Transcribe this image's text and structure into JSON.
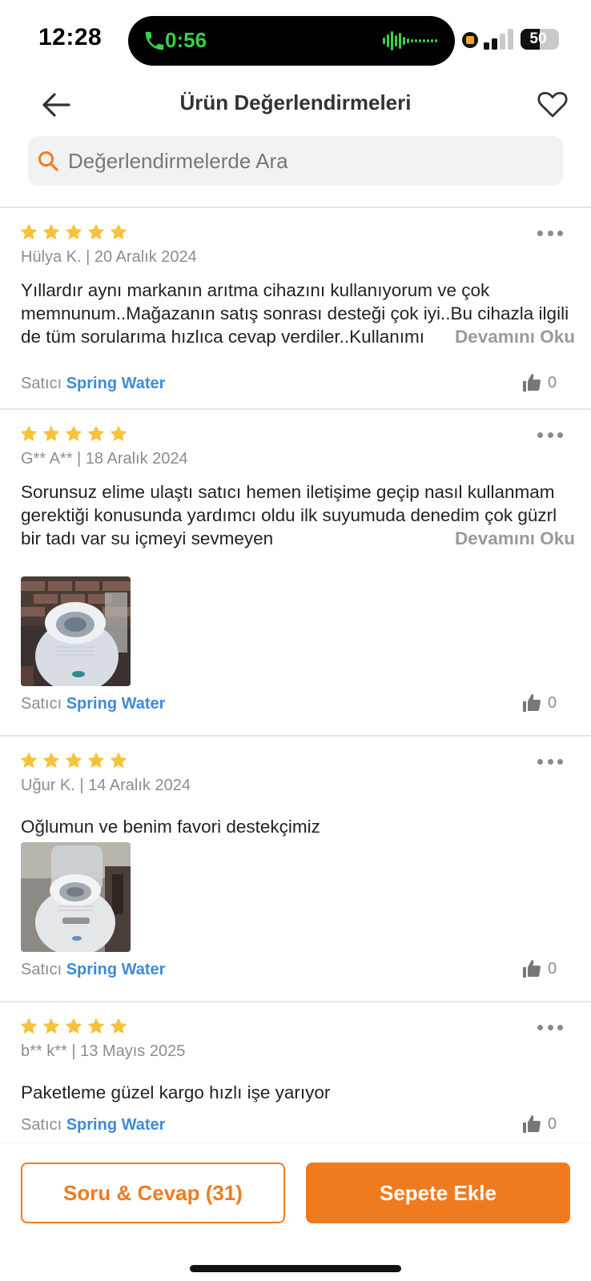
{
  "status_bar": {
    "time": "12:28",
    "call_timer": "0:56",
    "battery": "50",
    "battery_level": 0.5
  },
  "header": {
    "title": "Ürün Değerlendirmeleri",
    "back_icon": "arrow-left-icon",
    "favorite_icon": "heart-outline-icon"
  },
  "search": {
    "placeholder": "Değerlendirmelerde Ara",
    "value": ""
  },
  "colors": {
    "accent": "#f07b1f",
    "star": "#f7c23a",
    "seller_link": "#3d8bd9",
    "call_green": "#35d24a"
  },
  "reviews": [
    {
      "rating": 5,
      "author": "Hülya K.",
      "date": "20 Aralık 2024",
      "author_line": "Hülya K. | 20 Aralık 2024",
      "text": "Yıllardır aynı markanın arıtma cihazını kullanıyorum ve çok memnunum..Mağazanın satış sonrası desteği çok iyi..Bu cihazla ilgili de tüm sorularıma hızlıca cevap verdiler..Kullanımı",
      "read_more": "Devamını Oku",
      "has_photo": false,
      "seller_label": "Satıcı",
      "seller": "Spring Water",
      "likes": "0"
    },
    {
      "rating": 5,
      "author": "G** A**",
      "date": "18 Aralık 2024",
      "author_line": "G** A** | 18 Aralık 2024",
      "text": "Sorunsuz elime ulaştı satıcı hemen iletişime geçip nasıl kullanmam gerektiği konusunda yardımcı oldu ilk suyumuda denedim çok güzrl bir tadı var su içmeyi sevmeyen",
      "read_more": "Devamını Oku",
      "has_photo": true,
      "seller_label": "Satıcı",
      "seller": "Spring Water",
      "likes": "0"
    },
    {
      "rating": 5,
      "author": "Uğur K.",
      "date": "14 Aralık 2024",
      "author_line": "Uğur K. | 14 Aralık 2024",
      "text": "Oğlumun ve benim favori destekçimiz",
      "has_photo": true,
      "seller_label": "Satıcı",
      "seller": "Spring Water",
      "likes": "0"
    },
    {
      "rating": 5,
      "author": "b** k**",
      "date": "13 Mayıs 2025",
      "author_line": "b** k** | 13 Mayıs 2025",
      "text": "Paketleme güzel kargo hızlı işe yarıyor",
      "has_photo": false,
      "seller_label": "Satıcı",
      "seller": "Spring Water",
      "likes": "0"
    }
  ],
  "bottom_bar": {
    "qa_label": "Soru & Cevap (31)",
    "cart_label": "Sepete Ekle"
  }
}
